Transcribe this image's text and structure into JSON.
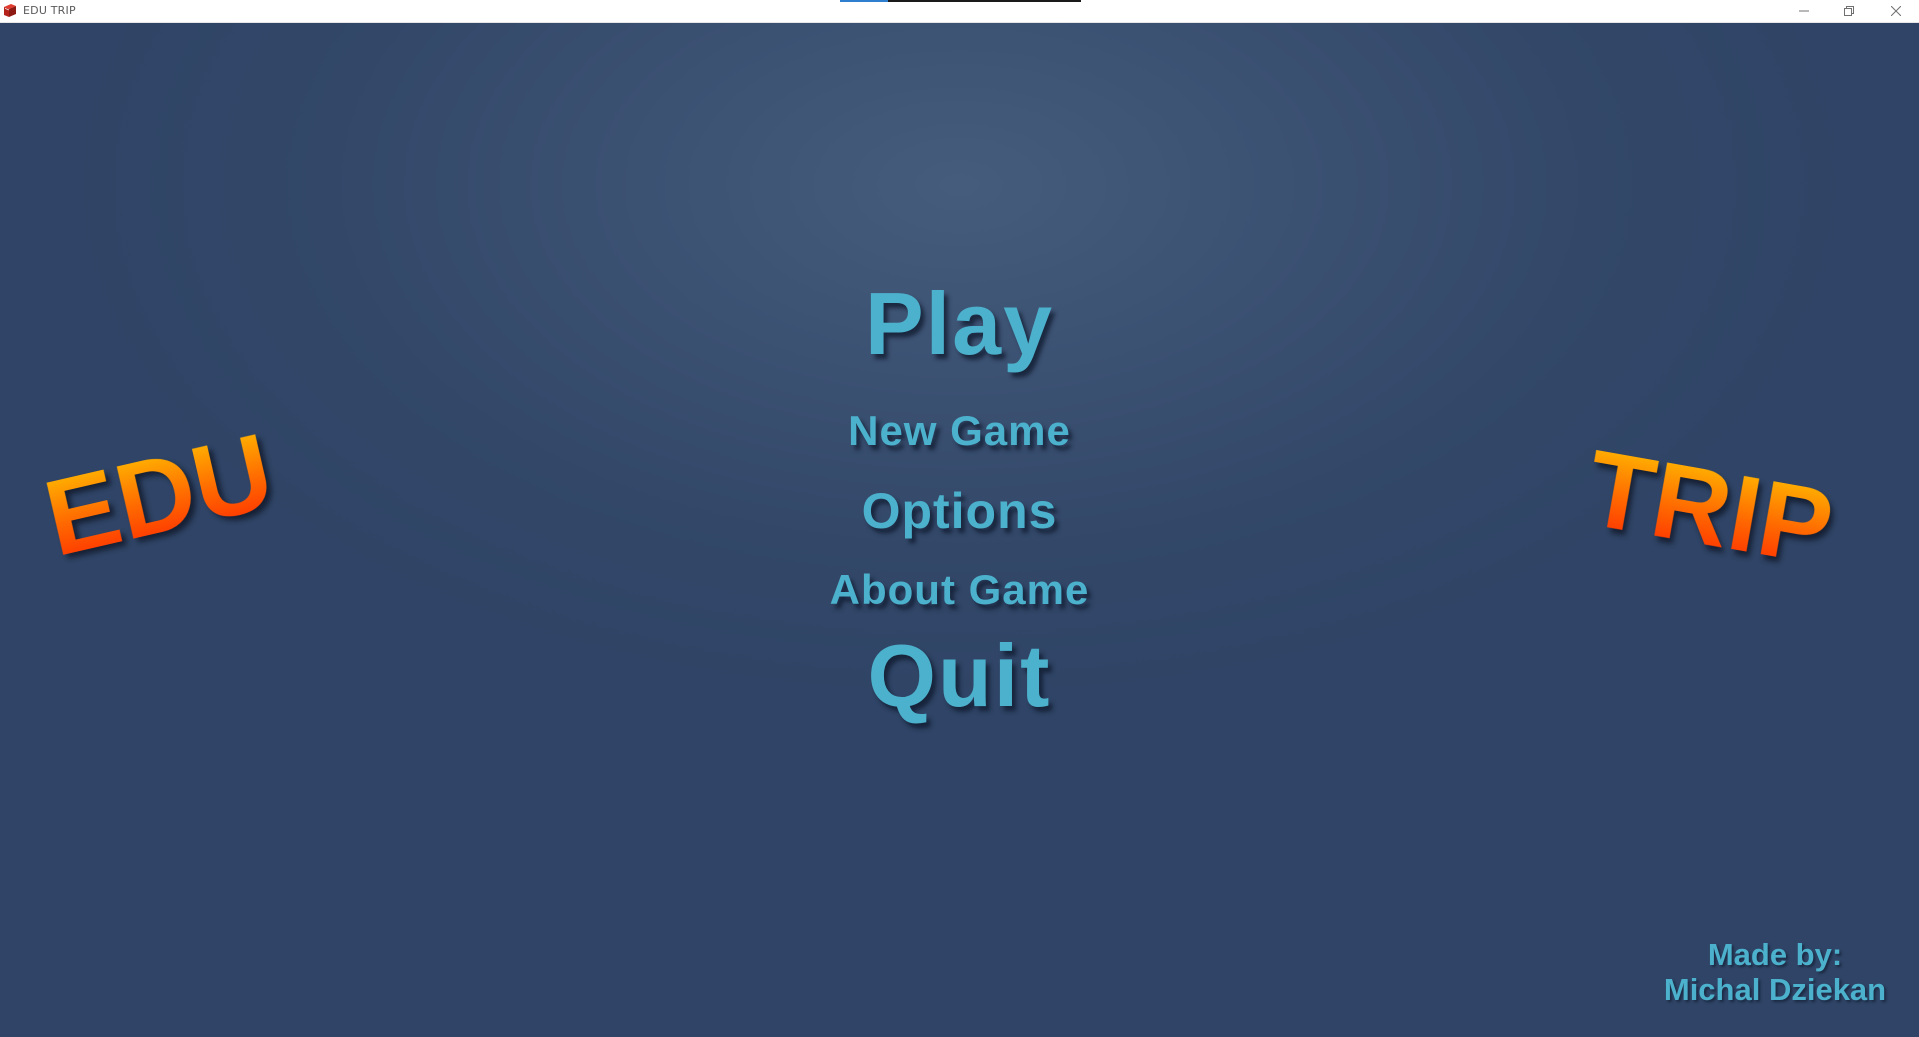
{
  "window": {
    "title": "EDU TRIP",
    "app_icon": "book-icon",
    "controls": {
      "minimize_icon": "minimize-icon",
      "maximize_icon": "restore-icon",
      "close_icon": "close-icon"
    }
  },
  "logo": {
    "left_word": "EDU",
    "right_word": "TRIP",
    "gradient_colors": [
      "#ffc400",
      "#ff6a00",
      "#ff2a00"
    ]
  },
  "menu": {
    "play": "Play",
    "new_game": "New Game",
    "options": "Options",
    "about": "About Game",
    "quit": "Quit",
    "text_color": "#4cb1cc"
  },
  "credits": {
    "line1": "Made by:",
    "line2": "Michal Dziekan"
  },
  "colors": {
    "background": "#3c5273",
    "titlebar": "#ffffff"
  }
}
